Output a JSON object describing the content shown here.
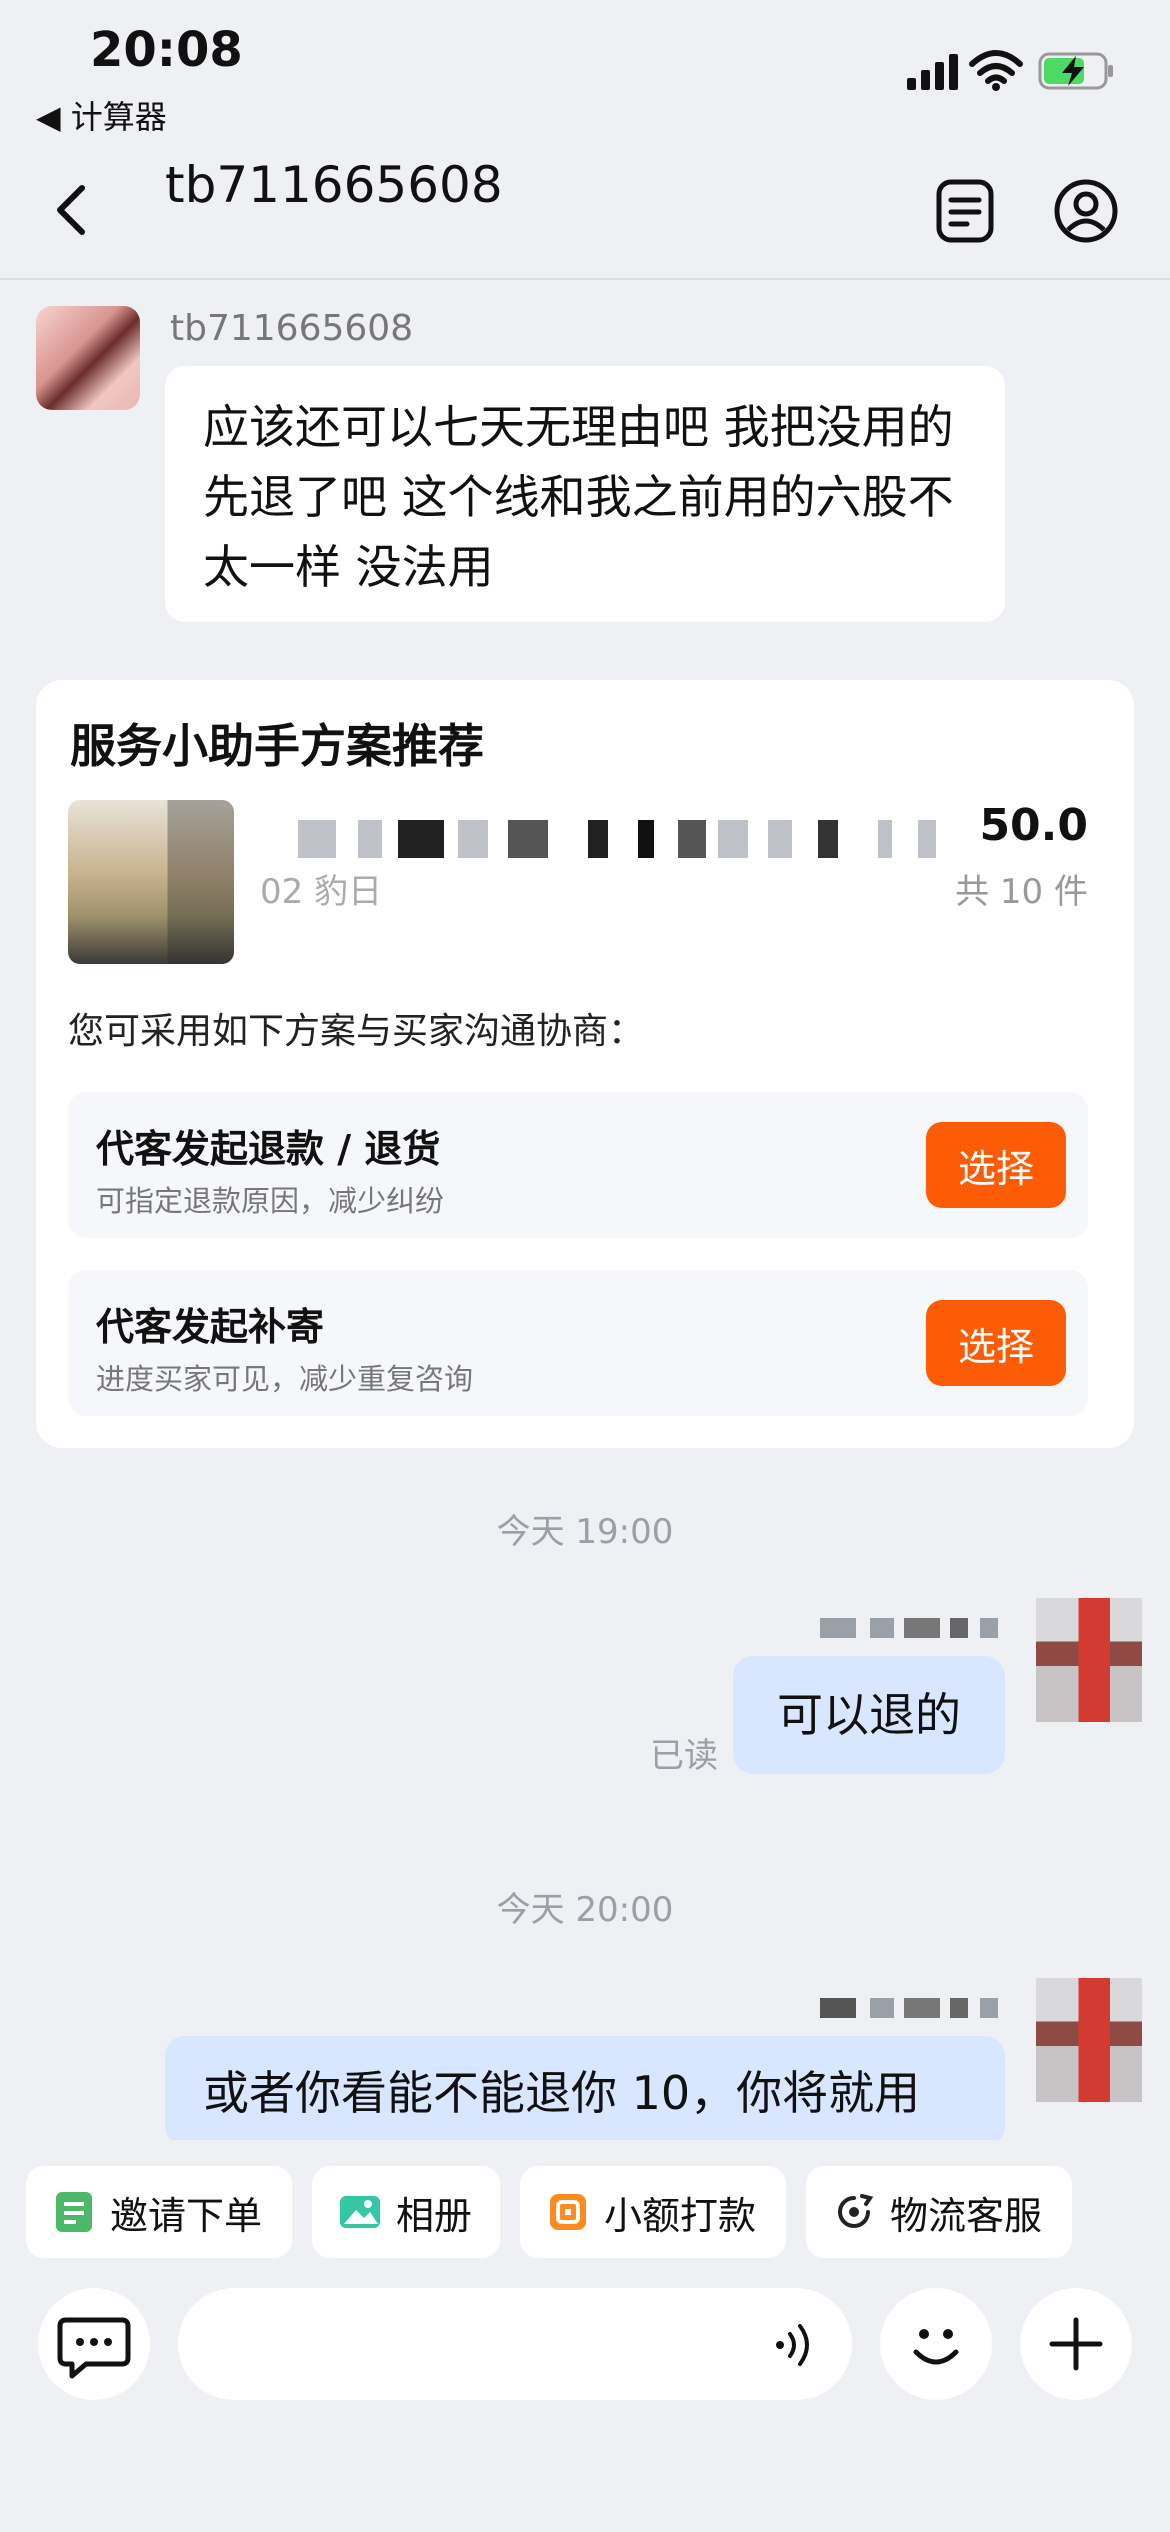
{
  "status_bar": {
    "time": "20:08",
    "back_app": "◀ 计算器"
  },
  "header": {
    "title": "tb711665608"
  },
  "messages": {
    "m1": {
      "sender": "tb711665608",
      "text": "应该还可以七天无理由吧 我把没用的先退了吧 这个线和我之前用的六股不太一样 没法用"
    },
    "service_card": {
      "title": "服务小助手方案推荐",
      "product_sub": "02 豹日",
      "product_price": "50.0",
      "product_count": "共 10 件",
      "hint": "您可采用如下方案与买家沟通协商：",
      "options": [
        {
          "title": "代客发起退款 / 退货",
          "desc": "可指定退款原因，减少纠纷",
          "button": "选择"
        },
        {
          "title": "代客发起补寄",
          "desc": "进度买家可见，减少重复咨询",
          "button": "选择"
        }
      ]
    },
    "stamp1": "今天 19:00",
    "m2": {
      "text": "可以退的",
      "read": "已读"
    },
    "stamp2": "今天 20:00",
    "m3": {
      "text": "或者你看能不能退你 10，你将就用"
    }
  },
  "quick_actions": [
    {
      "label": "邀请下单",
      "icon": "invite-order-icon",
      "color": "#4bb86a"
    },
    {
      "label": "相册",
      "icon": "album-icon",
      "color": "#35c6a3"
    },
    {
      "label": "小额打款",
      "icon": "small-payment-icon",
      "color": "#ff8a1f"
    },
    {
      "label": "物流客服",
      "icon": "logistics-service-icon",
      "color": "#222222"
    }
  ],
  "input": {
    "placeholder": ""
  },
  "colors": {
    "accent": "#fc5c06",
    "bubble_self": "#d8e6ff",
    "background": "#eef0f4"
  }
}
